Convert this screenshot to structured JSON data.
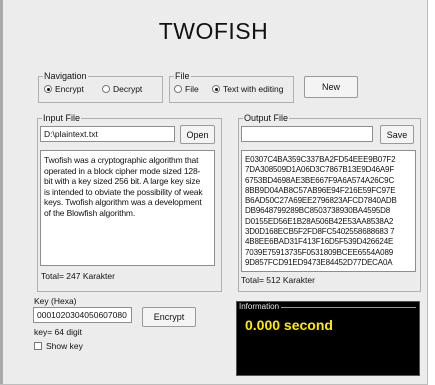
{
  "app": {
    "title": "TWOFISH"
  },
  "navigation": {
    "legend": "Navigation",
    "options": [
      {
        "label": "Encrypt",
        "selected": true
      },
      {
        "label": "Decrypt",
        "selected": false
      }
    ]
  },
  "file_mode": {
    "legend": "File",
    "options": [
      {
        "label": "File",
        "selected": false
      },
      {
        "label": "Text with editing",
        "selected": true
      }
    ]
  },
  "buttons": {
    "new": "New",
    "open": "Open",
    "save": "Save",
    "encrypt": "Encrypt"
  },
  "input_file": {
    "legend": "Input File",
    "path": "D:\\plaintext.txt",
    "text_lines": [
      "Twofish was a cryptographic algorithm that",
      "operated in a block cipher mode sized 128-",
      "bit with a key sized 256 bit. A large key size",
      "is intended to obviate the possibility of weak",
      "keys. Twofish algorithm was a development",
      "of the Blowfish algorithm."
    ],
    "total": "Total= 247 Karakter"
  },
  "output_file": {
    "legend": "Output File",
    "path": "",
    "hex_lines": [
      "E0307C4BA359C337BA2FD54EEE9B07F2",
      "7DA308509D1A06D3C7867B13E9D46A9F",
      "6753BD4698AE3BE667F9A6A574A26C9C",
      "8BB9D04AB8C57AB96E94F216E59FC97E",
      "B6AD50C27A69EE2796823AFCD7840ADB",
      "DB9648799289BC8503738930BA4595D8",
      "D0155ED56E1B28A506B42E53AA8538A2",
      "3D0D168ECB5F2FD8FC5402558688683 7",
      "4B8EE6BAD31F413F16D5F539D426624E",
      "7039E75913735F0531809BCEE6554A089",
      "9D857FCD91ED9473E84452D77DECA0A"
    ],
    "total": "Total= 512 Karakter"
  },
  "key": {
    "label": "Key (Hexa)",
    "value": "0001020304050607080",
    "digits": "key= 64 digit",
    "show_key": {
      "label": "Show key",
      "checked": false
    }
  },
  "information": {
    "legend": "Information",
    "value": "0.000 second"
  }
}
